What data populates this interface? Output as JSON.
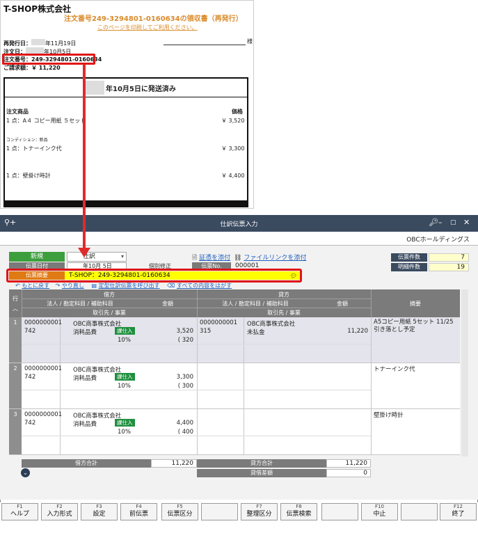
{
  "receipt": {
    "shop_name": "T-SHOP株式会社",
    "title": "注文番号249-3294801-0160634の領収書（再発行）",
    "print_note": "このページを印刷してご利用ください。",
    "reissue_label": "再発行日：",
    "reissue_date": "年11月19日",
    "order_date_label": "注文日：",
    "order_date": "年10月5日",
    "order_no_line": "注文番号：249-3294801-0160634",
    "amount_line": "ご請求額：￥ 11,220",
    "sama": "様",
    "ship_header": "年10月5日に発送済み",
    "col_item": "注文商品",
    "col_price": "価格",
    "items": [
      {
        "name": "1 点：A４ コピー用紙 ５セット",
        "price": "￥ 3,520"
      },
      {
        "condition": "コンディション：新品",
        "name": "1 点：トナーインク代",
        "price": "￥ 3,300"
      },
      {
        "name": "1 点：壁掛け時計",
        "price": "￥ 4,400"
      }
    ]
  },
  "window": {
    "title": "仕訳伝票入力",
    "company": "OBCホールディングス",
    "new_label": "新規",
    "type_value": "仕訳",
    "date_label": "伝票日付",
    "date_value": "年10月 5日",
    "individual_fix": "個別修正",
    "attach_evidence": "証憑を添付",
    "attach_filelink": "ファイルリンクを添付",
    "voucher_no_label": "伝票No.",
    "voucher_no": "000001",
    "summary_label": "伝票摘要",
    "summary_value": "T-SHOP：249-3294801-0160634",
    "links": {
      "undo": "もとに戻す",
      "redo": "やり直し",
      "recall": "定型仕訳伝票を呼び出す",
      "clear_all": "すべての内容をはがす"
    },
    "counts": {
      "slip_label": "伝票件数",
      "slip_value": "7",
      "detail_label": "明細件数",
      "detail_value": "19"
    }
  },
  "grid": {
    "row_header": "行",
    "debit": "借方",
    "credit": "貸方",
    "account_header": "法人 / 勘定科目 / 補助科目",
    "amount_header": "金額",
    "partner_header": "取引先 / 事業",
    "remarks_header": "摘要",
    "rows": [
      {
        "no": "1",
        "d_code": "0000000001",
        "d_company": "OBC商事株式会社",
        "d_sub": "742",
        "d_account": "消耗品費",
        "d_tax": "課仕入",
        "d_amount": "3,520",
        "d_rate": "10%",
        "d_taxamt": "( 320",
        "c_code": "0000000001",
        "c_company": "OBC商事株式会社",
        "c_sub": "315",
        "c_account": "未払金",
        "c_amount": "11,220",
        "remarks": "A5コピー用紙 5セット 11/25引き落とし予定"
      },
      {
        "no": "2",
        "d_code": "0000000001",
        "d_company": "OBC商事株式会社",
        "d_sub": "742",
        "d_account": "消耗品費",
        "d_tax": "課仕入",
        "d_amount": "3,300",
        "d_rate": "10%",
        "d_taxamt": "( 300",
        "remarks": "トナーインク代"
      },
      {
        "no": "3",
        "d_code": "0000000001",
        "d_company": "OBC商事株式会社",
        "d_sub": "742",
        "d_account": "消耗品費",
        "d_tax": "課仕入",
        "d_amount": "4,400",
        "d_rate": "10%",
        "d_taxamt": "( 400",
        "remarks": "壁掛け時計"
      }
    ],
    "totals": {
      "debit_label": "借方合計",
      "debit_value": "11,220",
      "credit_label": "貸方合計",
      "credit_value": "11,220",
      "diff_label": "貸借差額",
      "diff_value": "0"
    }
  },
  "fkeys": [
    {
      "key": "F1",
      "label": "ヘルプ"
    },
    {
      "key": "F2",
      "label": "入力形式"
    },
    {
      "key": "F3",
      "label": "設定"
    },
    {
      "key": "F4",
      "label": "前伝票"
    },
    {
      "key": "F5",
      "label": "伝票区分"
    },
    {
      "key": "",
      "label": ""
    },
    {
      "key": "F7",
      "label": "整理区分"
    },
    {
      "key": "F8",
      "label": "伝票検索"
    },
    {
      "key": "",
      "label": ""
    },
    {
      "key": "F10",
      "label": "中止"
    },
    {
      "key": "",
      "label": ""
    },
    {
      "key": "F12",
      "label": "終了"
    }
  ],
  "colors": {
    "accent": "#e01515",
    "titlebar": "#3a4a5f",
    "green": "#3d9e3d",
    "orange": "#e07a14",
    "highlight": "#ffff00"
  }
}
